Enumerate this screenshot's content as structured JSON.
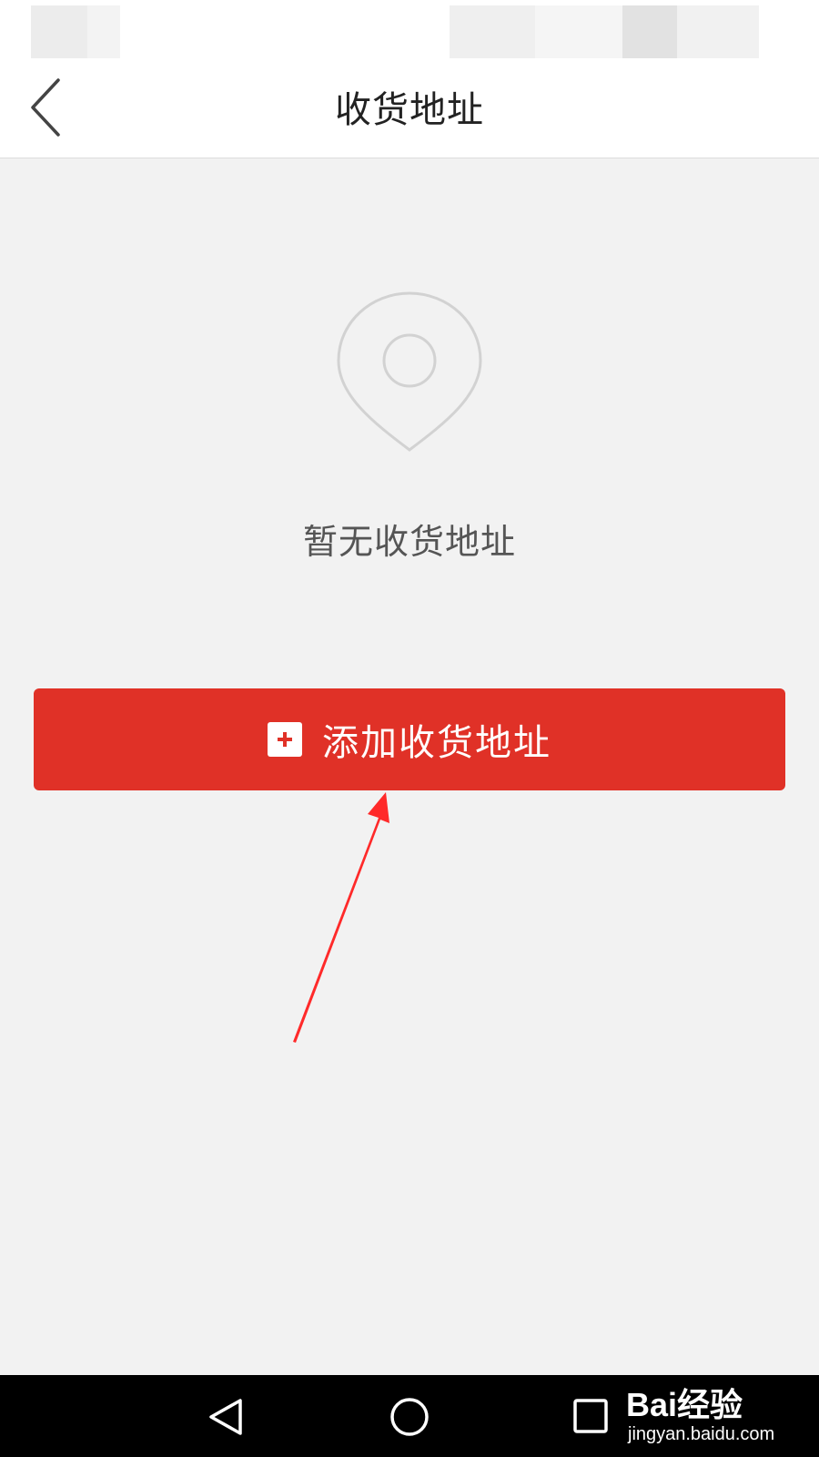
{
  "header": {
    "title": "收货地址",
    "back_icon": "chevron-left-icon"
  },
  "empty_state": {
    "icon": "location-pin-icon",
    "message": "暂无收货地址"
  },
  "add_button": {
    "icon": "plus-square-icon",
    "label": "添加收货地址"
  },
  "nav_bar": {
    "back_icon": "triangle-back-icon",
    "home_icon": "circle-home-icon",
    "recent_icon": "square-recents-icon"
  },
  "watermark": {
    "logo_text": "Bai经验",
    "url": "jingyan.baidu.com"
  },
  "colors": {
    "accent": "#e03127",
    "background": "#f2f2f2",
    "header_bg": "#ffffff",
    "nav_bg": "#000000",
    "annotation": "#ff2a2a"
  }
}
